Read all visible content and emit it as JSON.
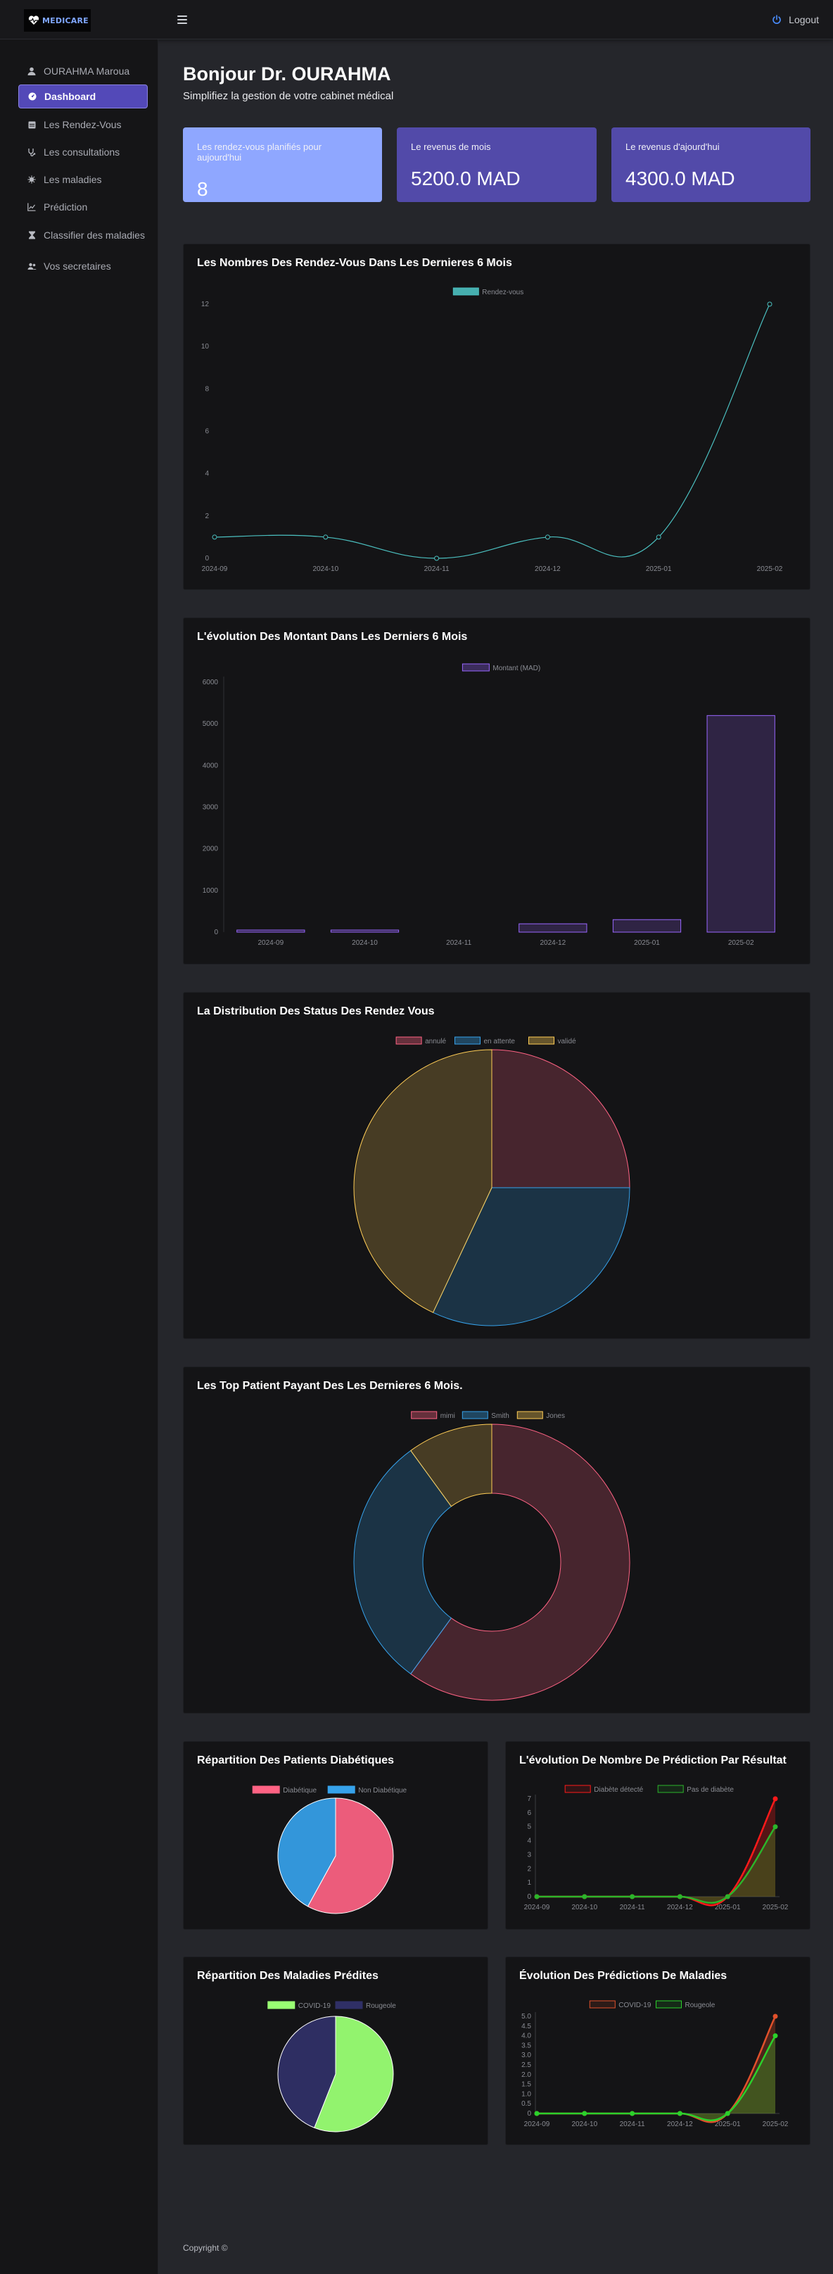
{
  "app": {
    "logo_text": "MEDICARE"
  },
  "header": {
    "logout_label": "Logout"
  },
  "sidebar": {
    "items": [
      {
        "label": "OURAHMA Maroua",
        "icon": "user-icon",
        "active": false
      },
      {
        "label": "Dashboard",
        "icon": "dashboard-icon",
        "active": true
      },
      {
        "label": "Les Rendez-Vous",
        "icon": "calendar-icon",
        "active": false
      },
      {
        "label": "Les consultations",
        "icon": "stethoscope-icon",
        "active": false
      },
      {
        "label": "Les maladies",
        "icon": "virus-icon",
        "active": false
      },
      {
        "label": "Prédiction",
        "icon": "chart-line-icon",
        "active": false
      },
      {
        "label": "Classifier des maladies",
        "icon": "hourglass-icon",
        "active": false
      },
      {
        "label": "Vos secretaires",
        "icon": "users-icon",
        "active": false
      }
    ]
  },
  "main": {
    "greeting": "Bonjour Dr. OURAHMA",
    "subtitle": "Simplifiez la gestion de votre cabinet médical",
    "stats": [
      {
        "label": "Les rendez-vous planifiés pour aujourd'hui",
        "value": "8",
        "color": "#8fa7ff"
      },
      {
        "label": "Le revenus de mois",
        "value": "5200.0 MAD",
        "color": "#524aa9"
      },
      {
        "label": "Le revenus d'ajourd'hui",
        "value": "4300.0 MAD",
        "color": "#524aa9"
      }
    ]
  },
  "footer": {
    "text": "Copyright ©"
  },
  "chart_data": [
    {
      "type": "line",
      "title": "Les Nombres Des Rendez-Vous Dans Les Dernieres 6 Mois",
      "x": [
        "2024-09",
        "2024-10",
        "2024-11",
        "2024-12",
        "2025-01",
        "2025-02"
      ],
      "series": [
        {
          "name": "Rendez-vous",
          "values": [
            1,
            1,
            0,
            1,
            1,
            12
          ],
          "color": "#4bc0c0"
        }
      ],
      "yticks": [
        "0",
        "2",
        "4",
        "6",
        "8",
        "10",
        "12"
      ],
      "ylim": [
        0,
        12
      ],
      "legend": "top-center",
      "grid": false
    },
    {
      "type": "bar",
      "title": "L'évolution Des Montant Dans Les Derniers 6 Mois",
      "categories": [
        "2024-09",
        "2024-10",
        "2024-11",
        "2024-12",
        "2025-01",
        "2025-02"
      ],
      "series": [
        {
          "name": "Montant (MAD)",
          "values": [
            50,
            50,
            0,
            200,
            300,
            5200
          ],
          "color": "#9966ff"
        }
      ],
      "yticks": [
        "0",
        "1000",
        "2000",
        "3000",
        "4000",
        "5000",
        "6000"
      ],
      "ylim": [
        0,
        6000
      ],
      "legend": "top-center",
      "grid": false
    },
    {
      "type": "pie",
      "title": "La Distribution Des Status Des Rendez Vous",
      "labels": [
        "annulé",
        "en attente",
        "validé"
      ],
      "values": [
        25,
        32,
        43
      ],
      "colors": [
        "#ff6384",
        "#36a2eb",
        "#ffcd56"
      ],
      "legend": "top-center"
    },
    {
      "type": "pie",
      "variant": "doughnut",
      "title": "Les Top Patient Payant Des Les Dernieres 6 Mois.",
      "labels": [
        "mimi",
        "Smith",
        "Jones"
      ],
      "values": [
        60,
        30,
        10
      ],
      "colors": [
        "#ff6384",
        "#36a2eb",
        "#ffcd56"
      ],
      "legend": "top-center"
    },
    {
      "type": "pie",
      "title": "Répartition Des Patients Diabétiques",
      "labels": [
        "Diabétique",
        "Non Diabétique"
      ],
      "values": [
        58,
        42
      ],
      "colors": [
        "#ff6384",
        "#36a2eb"
      ],
      "legend": "top-center"
    },
    {
      "type": "area",
      "title": "L'évolution De Nombre De Prédiction Par Résultat",
      "x": [
        "2024-09",
        "2024-10",
        "2024-11",
        "2024-12",
        "2025-01",
        "2025-02"
      ],
      "series": [
        {
          "name": "Diabète détecté",
          "values": [
            0,
            0,
            0,
            0,
            0,
            7
          ],
          "color": "#ff1a1a"
        },
        {
          "name": "Pas de diabète",
          "values": [
            0,
            0,
            0,
            0,
            0,
            5
          ],
          "color": "#2bb52b"
        }
      ],
      "yticks": [
        "0",
        "1",
        "2",
        "3",
        "4",
        "5",
        "6",
        "7"
      ],
      "ylim": [
        0,
        7
      ],
      "legend": "top-center"
    },
    {
      "type": "pie",
      "title": "Répartition Des Maladies Prédites",
      "labels": [
        "COVID-19",
        "Rougeole"
      ],
      "values": [
        56,
        44
      ],
      "colors": [
        "#99ff73",
        "#2f2f66"
      ],
      "legend": "top-center"
    },
    {
      "type": "area",
      "title": "Évolution Des Prédictions De Maladies",
      "x": [
        "2024-09",
        "2024-10",
        "2024-11",
        "2024-12",
        "2025-01",
        "2025-02"
      ],
      "series": [
        {
          "name": "COVID-19",
          "values": [
            0,
            0,
            0,
            0,
            0,
            5
          ],
          "color": "#e0502b"
        },
        {
          "name": "Rougeole",
          "values": [
            0,
            0,
            0,
            0,
            0,
            4
          ],
          "color": "#2bd12b"
        }
      ],
      "yticks": [
        "0",
        "0.5",
        "1.0",
        "1.5",
        "2.0",
        "2.5",
        "3.0",
        "3.5",
        "4.0",
        "4.5",
        "5.0"
      ],
      "ylim": [
        0,
        5
      ],
      "legend": "top-center"
    }
  ]
}
